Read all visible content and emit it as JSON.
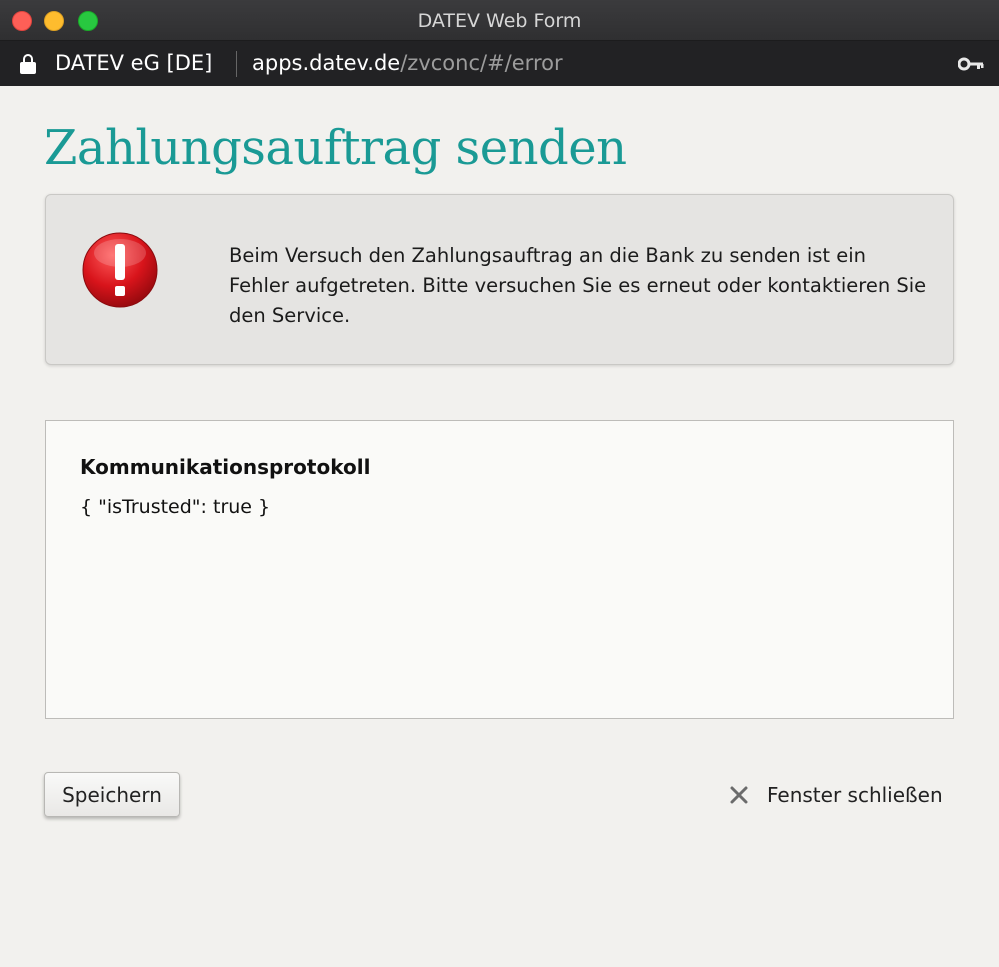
{
  "window": {
    "title": "DATEV Web Form"
  },
  "addressbar": {
    "certificate": "DATEV eG [DE]",
    "url_host": "apps.datev.de",
    "url_path": "/zvconc/#/error",
    "icons": {
      "lock": "lock-icon",
      "key": "key-icon"
    }
  },
  "page": {
    "title": "Zahlungsauftrag senden"
  },
  "error": {
    "icon": "error-exclamation-icon",
    "message": "Beim Versuch den Zahlungsauftrag an die Bank zu senden ist ein Fehler aufgetreten. Bitte versuchen Sie es erneut oder kontaktieren Sie den Service."
  },
  "protocol": {
    "title": "Kommunikationsprotokoll",
    "content": "{ \"isTrusted\": true }"
  },
  "actions": {
    "save_label": "Speichern",
    "close_label": "Fenster schließen"
  },
  "colors": {
    "title_accent": "#1a9a95",
    "error_red": "#d8141b"
  }
}
